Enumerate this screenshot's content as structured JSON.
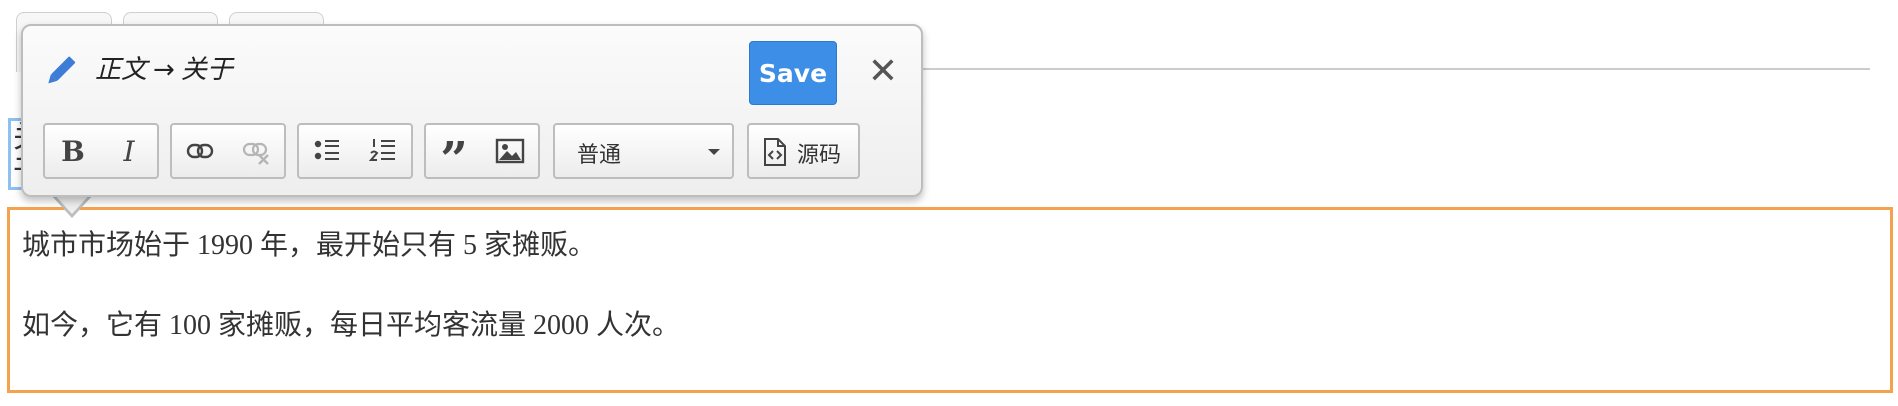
{
  "popup": {
    "breadcrumb": {
      "from": "正文",
      "arrow": "→",
      "to": "关于"
    },
    "save_label": "Save",
    "close_label": "✕",
    "toolbar": {
      "bold_label": "B",
      "italic_label": "I",
      "quote_label": "”",
      "format_select": {
        "selected": "普通"
      },
      "source_label": "源码"
    }
  },
  "background_field": {
    "text": "关于"
  },
  "content": {
    "paragraphs": [
      "城市市场始于 1990 年，最开始只有 5 家摊贩。",
      "如今，它有 100 家摊贩，每日平均客流量 2000 人次。"
    ]
  },
  "colors": {
    "save_button": "#3d8ee6",
    "active_editor_border": "#f4a24d",
    "field_border": "#8ec1ef",
    "pencil_icon": "#3d7dd8"
  },
  "icons": {
    "edit": "pencil-icon",
    "close": "close-icon",
    "link": "link-icon",
    "unlink": "unlink-icon",
    "bulleted_list": "bulleted-list-icon",
    "numbered_list": "numbered-list-icon",
    "blockquote": "blockquote-icon",
    "image": "image-icon",
    "dropdown": "chevron-down-icon",
    "source": "source-code-icon"
  }
}
